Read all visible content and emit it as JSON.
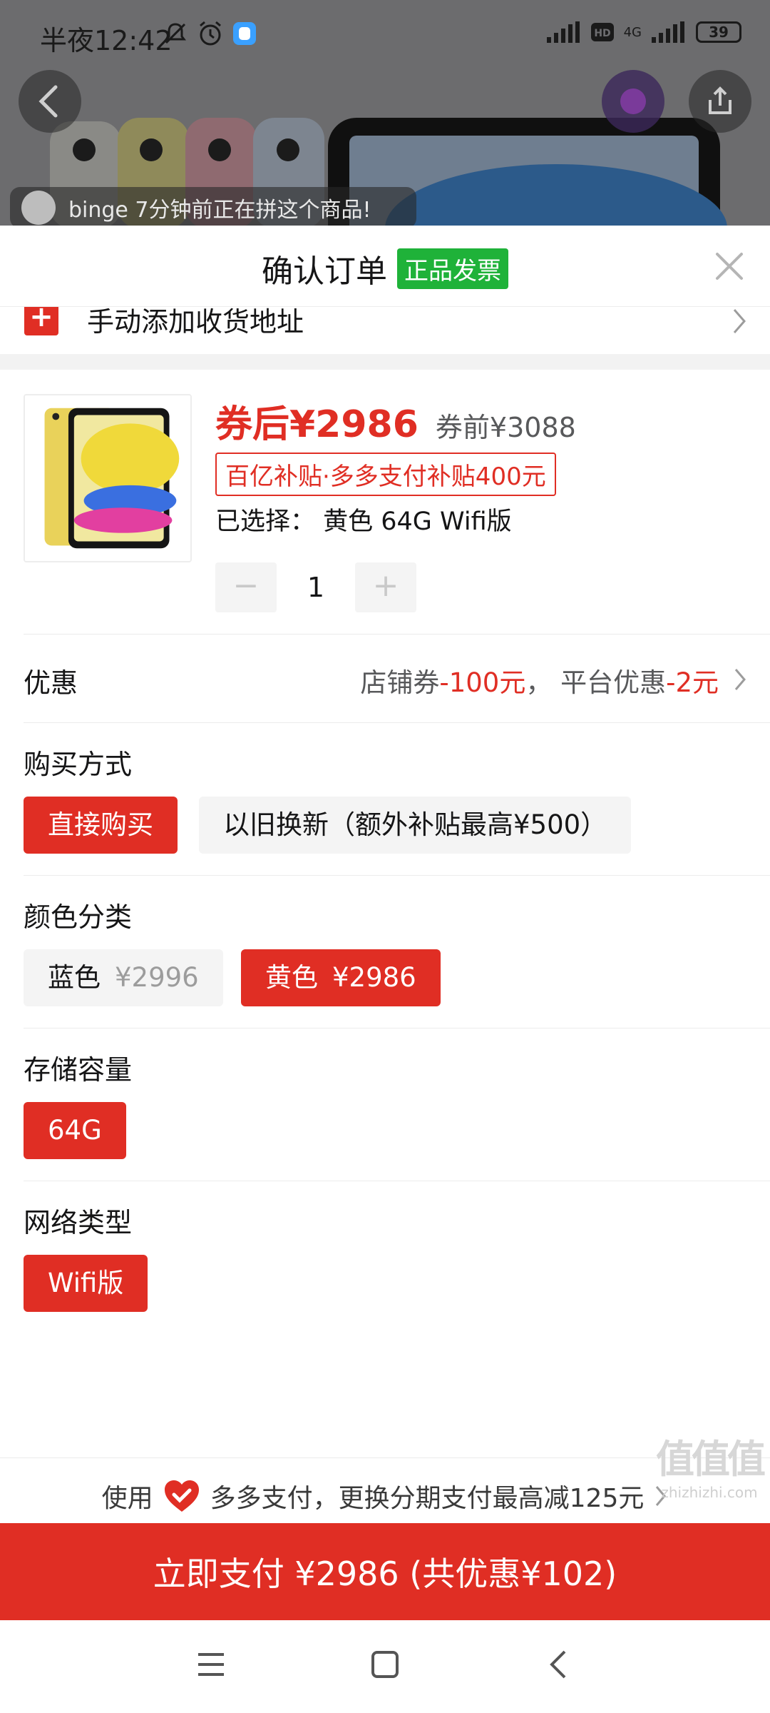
{
  "status_bar": {
    "time": "半夜12:42",
    "battery": "39",
    "network": "4G"
  },
  "background": {
    "group_banner": "binge 7分钟前正在拼这个商品!"
  },
  "sheet": {
    "title": "确认订单",
    "invoice_tag": "正品发票",
    "address_label": "手动添加收货地址"
  },
  "product": {
    "price_after": "券后¥2986",
    "price_before": "券前¥3088",
    "subsidy_tag": "百亿补贴·多多支付补贴400元",
    "selected": "已选择：  黄色 64G Wifi版",
    "quantity": "1",
    "minus": "−",
    "plus": "+"
  },
  "discount": {
    "label": "优惠",
    "shop_prefix": "店铺券",
    "shop_value": "-100元",
    "separator": "，  平台优惠",
    "platform_value": "-2元"
  },
  "purchase_method": {
    "label": "购买方式",
    "options": [
      "直接购买",
      "以旧换新（额外补贴最高¥500）"
    ]
  },
  "color": {
    "label": "颜色分类",
    "options": [
      {
        "name": "蓝色",
        "price": "¥2996"
      },
      {
        "name": "黄色",
        "price": "¥2986"
      }
    ]
  },
  "storage": {
    "label": "存储容量",
    "options": [
      "64G"
    ]
  },
  "network_type": {
    "label": "网络类型",
    "options": [
      "Wifi版"
    ]
  },
  "installment": {
    "prefix": "使用",
    "text": "多多支付，更换分期支付最高减125元"
  },
  "pay_button": "立即支付 ¥2986 (共优惠¥102)",
  "watermark": {
    "glyphs": "值值值",
    "site": "zhizhizhi.com"
  },
  "colors": {
    "accent": "#e02e24",
    "invoice_green": "#1fb239",
    "chip_inactive": "#f4f4f4"
  }
}
